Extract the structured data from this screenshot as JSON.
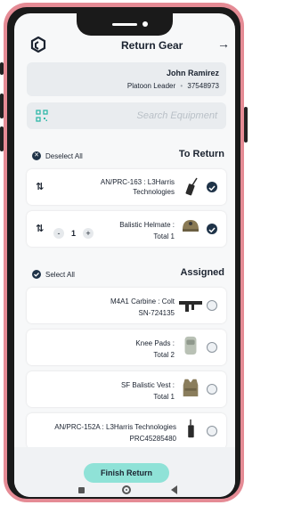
{
  "header": {
    "title": "Return Gear",
    "forward_icon": "arrow-right-icon",
    "logo_icon": "app-logo-icon"
  },
  "user": {
    "name": "John Ramirez",
    "role": "Platoon Leader",
    "id": "37548973"
  },
  "search": {
    "placeholder": "Search Equipment",
    "icon": "qr-scan-icon"
  },
  "to_return": {
    "action_label": "Deselect All",
    "title": "To Return",
    "items": [
      {
        "title_l1": "AN/PRC-163 : L3Harris",
        "title_l2": "Technologies"
      },
      {
        "title": "Balistic Helmate :",
        "total_label": "Total",
        "total": "1",
        "qty": "1"
      }
    ]
  },
  "assigned": {
    "action_label": "Select All",
    "title": "Assigned",
    "items": [
      {
        "title": "M4A1 Carbine : Colt",
        "sub": "SN-724135"
      },
      {
        "title": "Knee Pads :",
        "total_label": "Total",
        "total": "2"
      },
      {
        "title": "SF Balistic Vest :",
        "total_label": "Total",
        "total": "1"
      },
      {
        "title": "AN/PRC-152A : L3Harris Technologies",
        "sub": "PRC45285480"
      }
    ]
  },
  "footer": {
    "button_label": "Finish Return"
  },
  "colors": {
    "accent": "#8fe2d7",
    "dark": "#1f3348",
    "frame": "#e58b95"
  }
}
